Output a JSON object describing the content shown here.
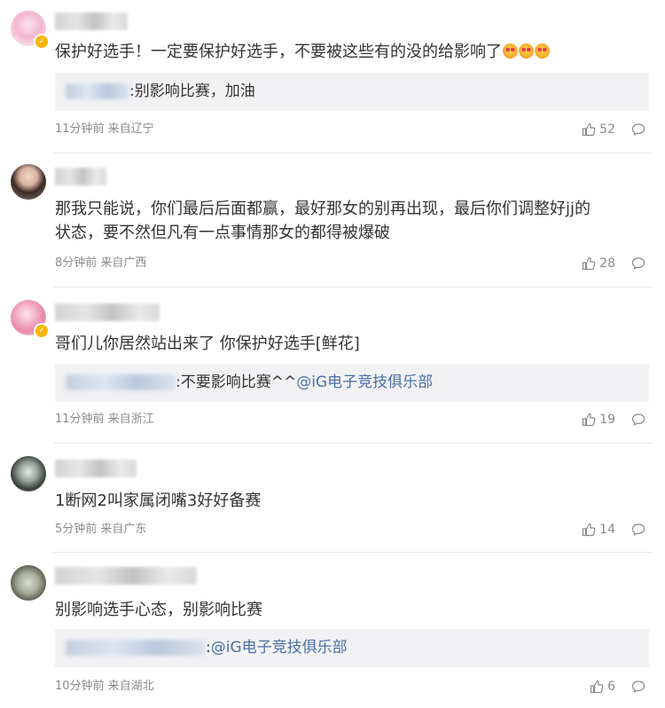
{
  "comments": [
    {
      "text_lines": [
        "保护好选手！一定要保护好选手，不要被这些有的没的给影响了"
      ],
      "emoji_count": 3,
      "reply": {
        "text": ":别影响比赛，加油",
        "mention": ""
      },
      "time_location": "11分钟前 来自辽宁",
      "likes": "52",
      "verified": true
    },
    {
      "text_lines": [
        "那我只能说，你们最后后面都赢，最好那女的别再出现，最后你们调整好jj的",
        "状态，要不然但凡有一点事情那女的都得被爆破"
      ],
      "time_location": "8分钟前 来自广西",
      "likes": "28",
      "verified": false
    },
    {
      "text_lines": [
        "哥们儿你居然站出来了 你保护好选手[鲜花]"
      ],
      "reply": {
        "text": ":不要影响比赛^^",
        "mention": "@iG电子竞技俱乐部"
      },
      "time_location": "11分钟前 来自浙江",
      "likes": "19",
      "verified": true
    },
    {
      "text_lines": [
        "1断网2叫家属闭嘴3好好备赛"
      ],
      "time_location": "5分钟前 来自广东",
      "likes": "14",
      "verified": false
    },
    {
      "text_lines": [
        "别影响选手心态，别影响比赛"
      ],
      "reply": {
        "text": ":",
        "mention": "@iG电子竞技俱乐部"
      },
      "time_location": "10分钟前 来自湖北",
      "likes": "6",
      "verified": false
    }
  ],
  "icons": {
    "like": "thumbs-up-icon",
    "reply": "comment-bubble-icon",
    "verified": "verified-badge-icon"
  },
  "colors": {
    "mention": "#4a6fa5",
    "meta": "#8b8b8b",
    "reply_bg": "#f2f2f5",
    "verified": "#f7b500"
  }
}
